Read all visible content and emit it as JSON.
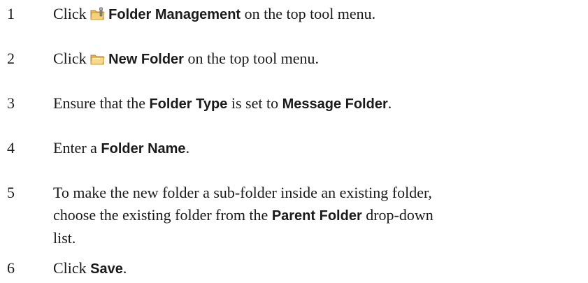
{
  "steps": [
    {
      "num": "1",
      "pre": "Click ",
      "icon": "folder-management-icon",
      "bold": "Folder Management",
      "post": " on the top tool menu."
    },
    {
      "num": "2",
      "pre": "Click ",
      "icon": "new-folder-icon",
      "bold": "New Folder",
      "post": " on the top tool menu."
    },
    {
      "num": "3",
      "pre": "Ensure that the ",
      "bold1": "Folder Type",
      "mid": " is set to ",
      "bold2": "Message Folder",
      "post": "."
    },
    {
      "num": "4",
      "pre": "Enter a ",
      "bold": "Folder Name",
      "post": "."
    },
    {
      "num": "5",
      "line1": "To make the new folder a sub-folder inside an existing folder,",
      "line2_pre": "choose the existing folder from the ",
      "line2_bold": "Parent Folder",
      "line2_post": " drop-down",
      "line3": "list."
    },
    {
      "num": "6",
      "pre": "Click ",
      "bold": "Save",
      "post": "."
    }
  ]
}
